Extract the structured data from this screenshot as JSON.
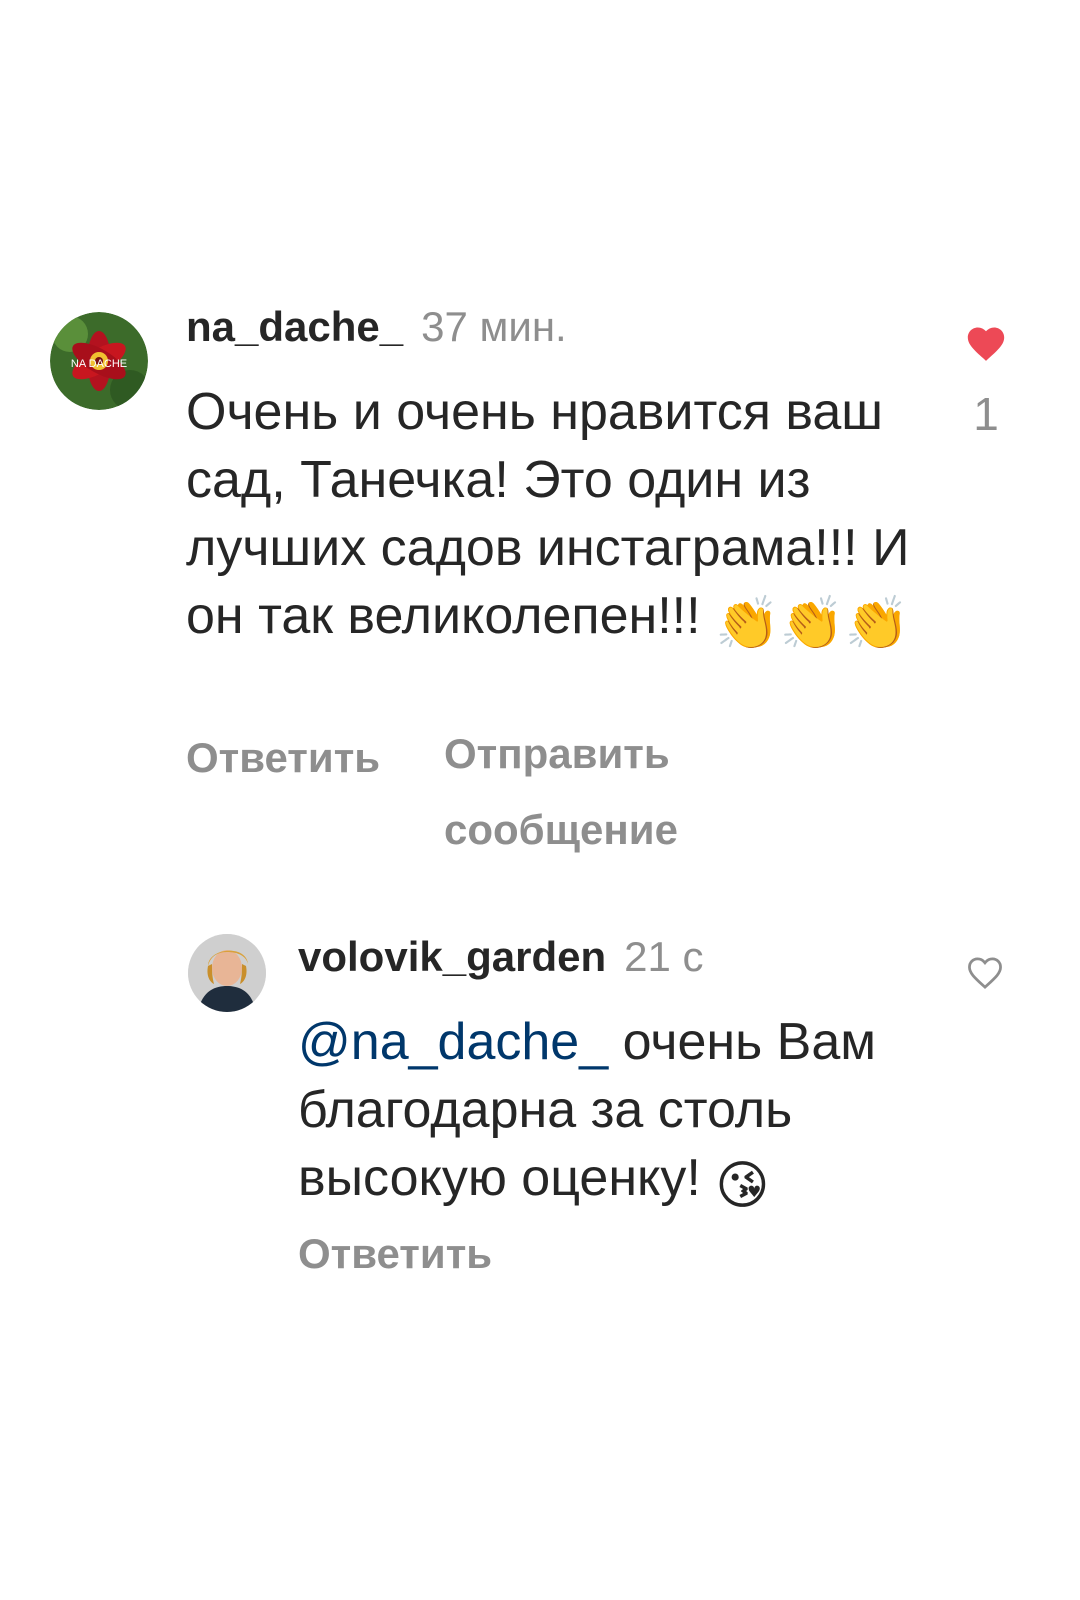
{
  "comments": [
    {
      "username": "na_dache_",
      "time": "37 мин.",
      "avatar_text": "NA DACHE",
      "text": "Очень и очень нравится ваш сад, Танечка! Это один из лучших садов инстаграма!!! И он так великолепен!!!",
      "emoji": [
        "👏",
        "👏",
        "👏"
      ],
      "actions": {
        "reply_label": "Ответить",
        "send_message_label": "Отправить сообщение"
      },
      "likes": "1",
      "liked": true
    },
    {
      "username": "volovik_garden",
      "time": "21 с",
      "mention": "@na_dache_",
      "text": "очень Вам благодарна за столь высокую оценку!",
      "emoji": [
        "😘"
      ],
      "actions": {
        "reply_label": "Ответить"
      },
      "liked": false
    }
  ],
  "colors": {
    "text": "#262626",
    "secondary": "#8e8e8e",
    "mention": "#00376b",
    "like_red": "#ed4956"
  },
  "icons": {
    "liked_heart": "heart-filled-icon",
    "unliked_heart": "heart-outline-icon"
  }
}
